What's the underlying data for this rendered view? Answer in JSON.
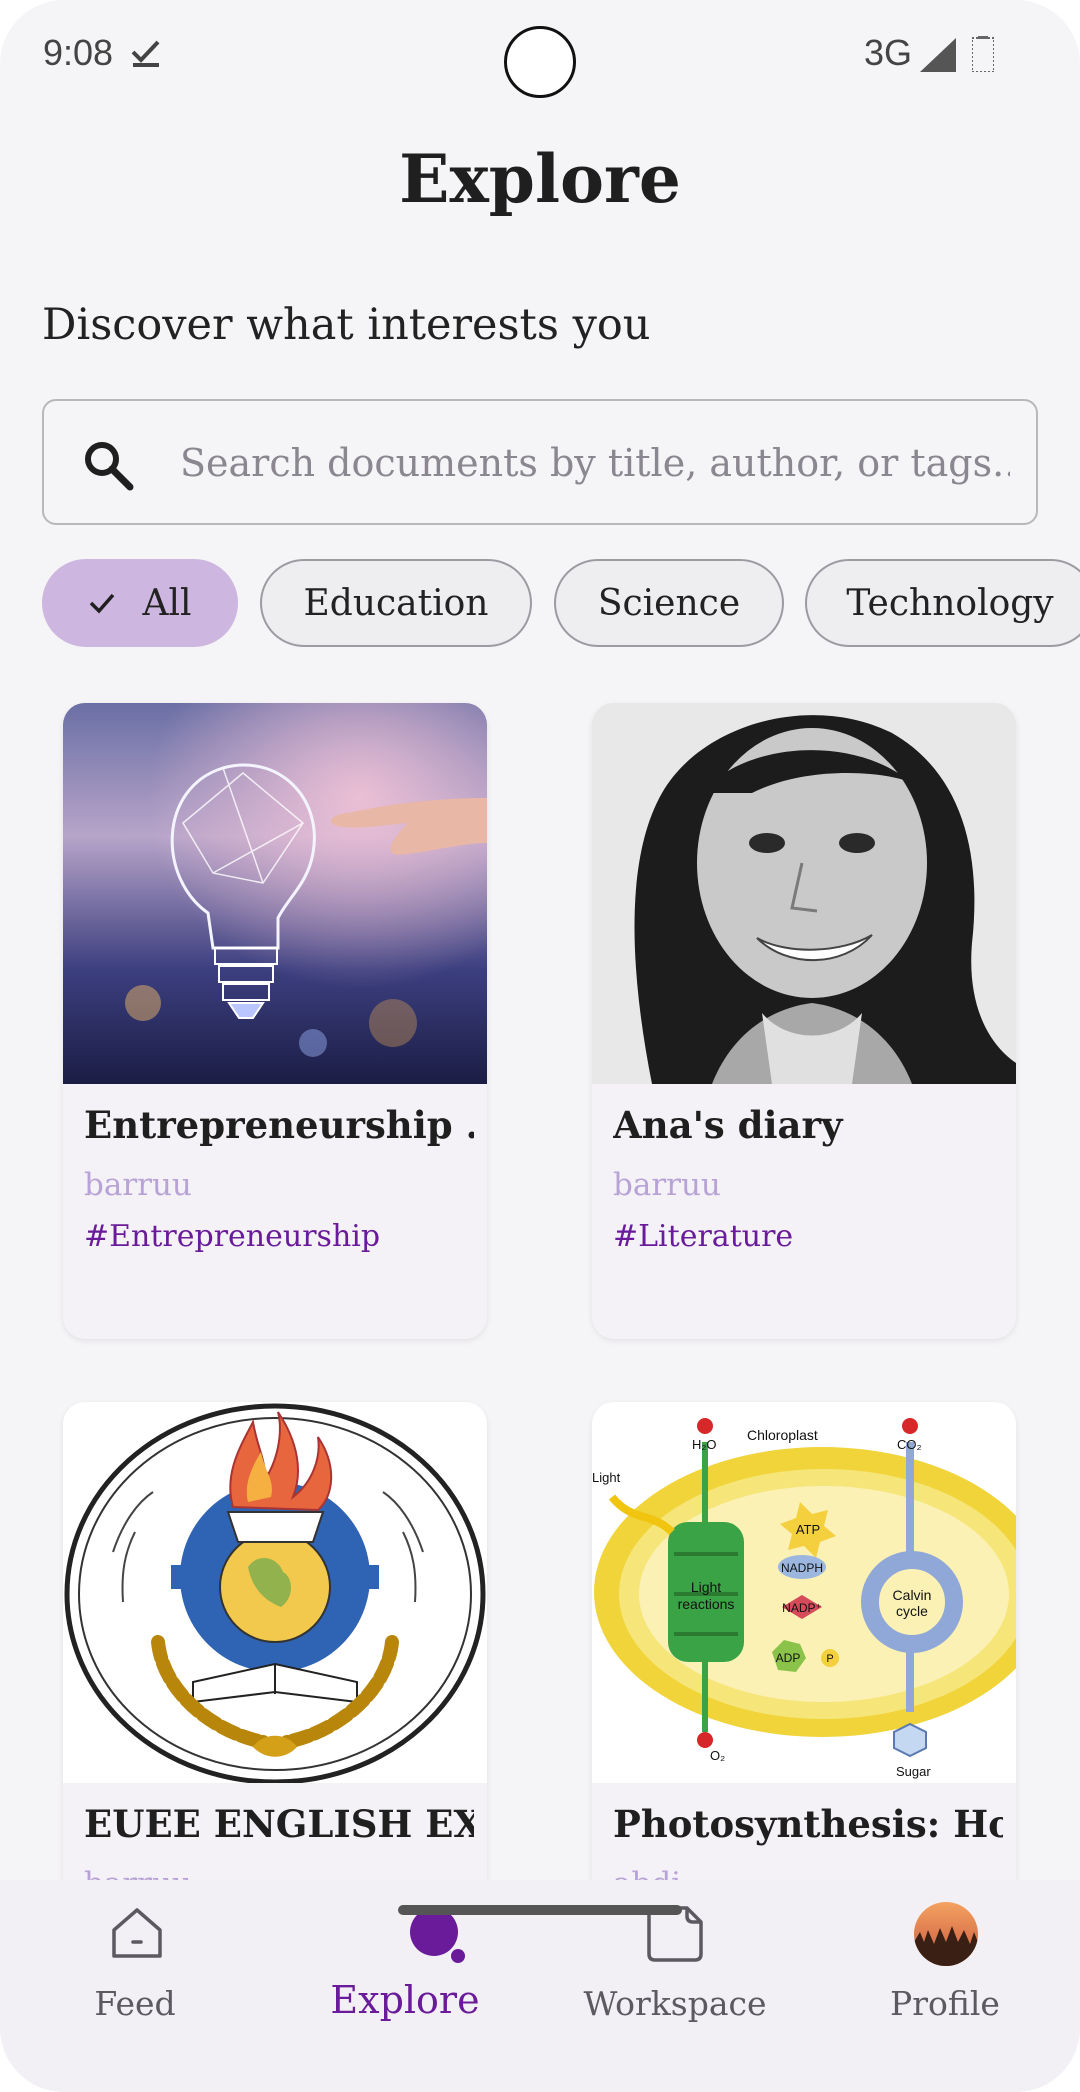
{
  "status": {
    "time": "9:08",
    "network": "3G"
  },
  "header": {
    "title": "Explore",
    "subtitle": "Discover what interests you"
  },
  "search": {
    "placeholder": "Search documents by title, author, or tags...",
    "value": ""
  },
  "filters": [
    {
      "label": "All",
      "selected": true
    },
    {
      "label": "Education",
      "selected": false
    },
    {
      "label": "Science",
      "selected": false
    },
    {
      "label": "Technology",
      "selected": false
    }
  ],
  "documents": [
    {
      "title": "Entrepreneurship ...",
      "author": "barruu",
      "tag": "#Entrepreneurship",
      "image": "lightbulb-image"
    },
    {
      "title": "Ana's diary",
      "author": "barruu",
      "tag": "#Literature",
      "image": "portrait-photo"
    },
    {
      "title": "EUEE ENGLISH  EX...",
      "author": "barruu",
      "tag": "",
      "image": "emblem-logo"
    },
    {
      "title": "Photosynthesis: Ho...",
      "author": "abdi",
      "tag": "",
      "image": "chloroplast-diagram"
    }
  ],
  "diagram_text": {
    "chloroplast": "Chloroplast",
    "h2o": "H₂O",
    "co2": "CO₂",
    "light": "Light",
    "light_reactions_1": "Light",
    "light_reactions_2": "reactions",
    "atp": "ATP",
    "nadph": "NADPH",
    "nadp": "NADP⁺",
    "adp": "ADP",
    "p": "P",
    "calvin_1": "Calvin",
    "calvin_2": "cycle",
    "o2": "O₂",
    "sugar": "Sugar"
  },
  "nav": {
    "items": [
      {
        "label": "Feed",
        "icon": "home-icon",
        "active": false
      },
      {
        "label": "Explore",
        "icon": "explore-icon",
        "active": true
      },
      {
        "label": "Workspace",
        "icon": "note-icon",
        "active": false
      },
      {
        "label": "Profile",
        "icon": "avatar",
        "active": false
      }
    ]
  },
  "colors": {
    "accent": "#6a1b9a",
    "chip_selected": "#cdb6df",
    "author": "#b7a3d6",
    "background": "#f5f4f6"
  }
}
